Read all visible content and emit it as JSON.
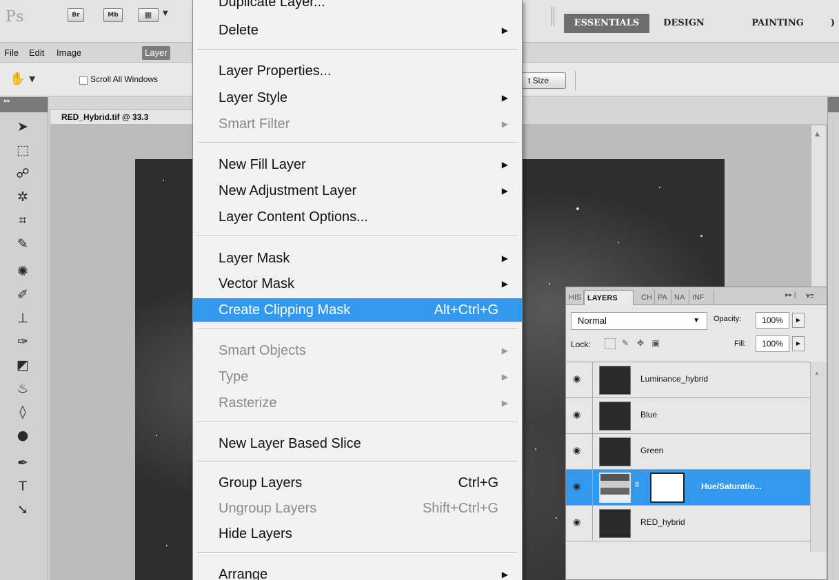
{
  "app": {
    "logo": "Ps",
    "bridge_label": "Br",
    "minibridge_label": "Mb"
  },
  "workspaces": [
    "ESSENTIALS",
    "DESIGN",
    "PAINTING",
    ")"
  ],
  "menubar": {
    "file": "File",
    "edit": "Edit",
    "image": "Image",
    "layer": "Layer"
  },
  "options": {
    "scroll_all_windows": "Scroll All Windows",
    "print_size_button": "t Size"
  },
  "document": {
    "tab_title": "RED_Hybrid.tif @ 33.3"
  },
  "layer_menu": {
    "items": [
      {
        "label": "Duplicate Layer...",
        "shortcut": "",
        "submenu": false,
        "disabled": false
      },
      {
        "label": "Delete",
        "shortcut": "",
        "submenu": true,
        "disabled": false
      },
      {
        "label": "Layer Properties...",
        "shortcut": "",
        "submenu": false,
        "disabled": false
      },
      {
        "label": "Layer Style",
        "shortcut": "",
        "submenu": true,
        "disabled": false
      },
      {
        "label": "Smart Filter",
        "shortcut": "",
        "submenu": true,
        "disabled": true
      },
      {
        "label": "New Fill Layer",
        "shortcut": "",
        "submenu": true,
        "disabled": false
      },
      {
        "label": "New Adjustment Layer",
        "shortcut": "",
        "submenu": true,
        "disabled": false
      },
      {
        "label": "Layer Content Options...",
        "shortcut": "",
        "submenu": false,
        "disabled": false
      },
      {
        "label": "Layer Mask",
        "shortcut": "",
        "submenu": true,
        "disabled": false
      },
      {
        "label": "Vector Mask",
        "shortcut": "",
        "submenu": true,
        "disabled": false
      },
      {
        "label": "Create Clipping Mask",
        "shortcut": "Alt+Ctrl+G",
        "submenu": false,
        "disabled": false,
        "highlighted": true
      },
      {
        "label": "Smart Objects",
        "shortcut": "",
        "submenu": true,
        "disabled": true
      },
      {
        "label": "Type",
        "shortcut": "",
        "submenu": true,
        "disabled": true
      },
      {
        "label": "Rasterize",
        "shortcut": "",
        "submenu": true,
        "disabled": true
      },
      {
        "label": "New Layer Based Slice",
        "shortcut": "",
        "submenu": false,
        "disabled": false
      },
      {
        "label": "Group Layers",
        "shortcut": "Ctrl+G",
        "submenu": false,
        "disabled": false
      },
      {
        "label": "Ungroup Layers",
        "shortcut": "Shift+Ctrl+G",
        "submenu": false,
        "disabled": true
      },
      {
        "label": "Hide Layers",
        "shortcut": "",
        "submenu": false,
        "disabled": false
      },
      {
        "label": "Arrange",
        "shortcut": "",
        "submenu": true,
        "disabled": false
      }
    ]
  },
  "layers_panel": {
    "tabs": [
      "HIS",
      "LAYERS",
      "CH",
      "PA",
      "NA",
      "INF"
    ],
    "blend_mode": "Normal",
    "opacity_label": "Opacity:",
    "opacity_value": "100%",
    "lock_label": "Lock:",
    "fill_label": "Fill:",
    "fill_value": "100%",
    "layers": [
      {
        "name": "Luminance_hybrid",
        "selected": false
      },
      {
        "name": "Blue",
        "selected": false
      },
      {
        "name": "Green",
        "selected": false
      },
      {
        "name": "Hue/Saturatio...",
        "selected": true
      },
      {
        "name": "RED_hybrid",
        "selected": false
      }
    ]
  },
  "icons": {
    "eye": "eye-icon",
    "chain": "chain-link-icon",
    "hand": "hand-tool-icon"
  },
  "colors": {
    "highlight": "#3399ee",
    "menu_bg": "#f2f2f2",
    "workspace_active": "#6e6e6e"
  }
}
